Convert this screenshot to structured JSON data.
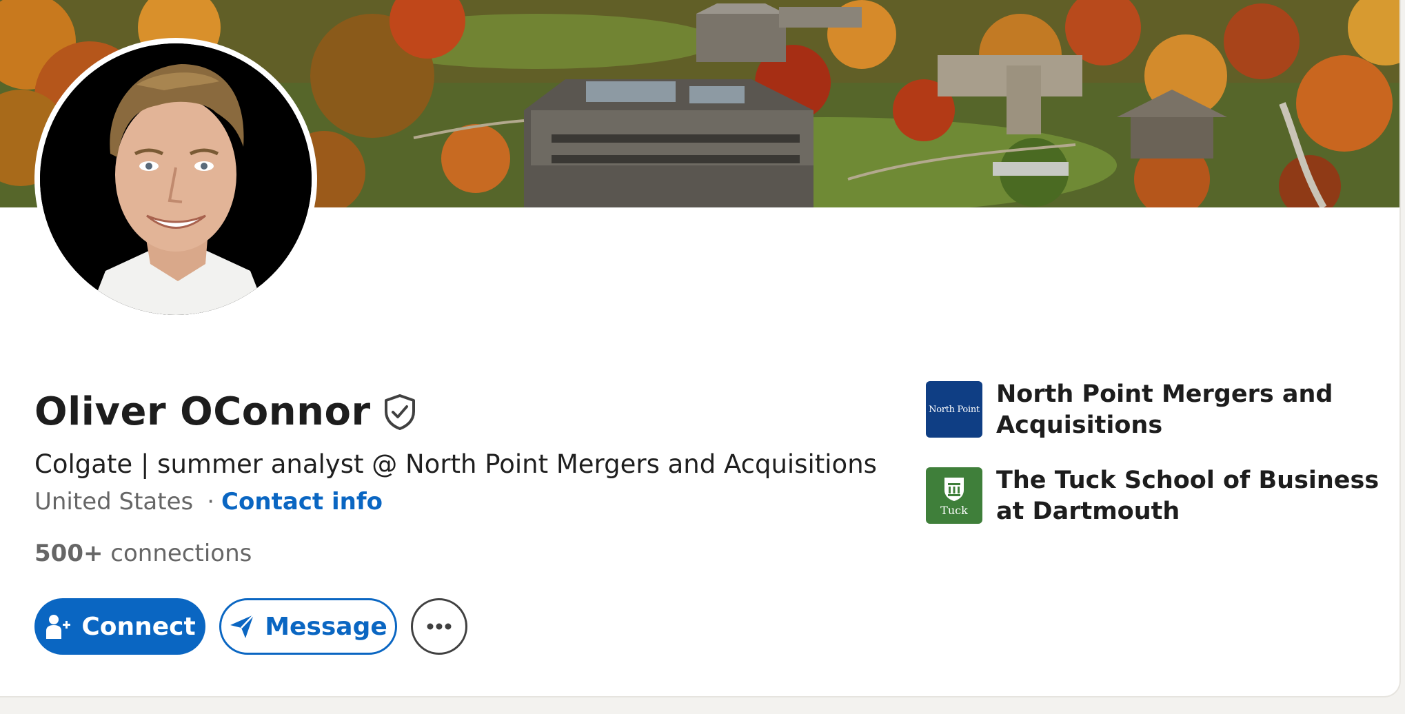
{
  "profile": {
    "name": "Oliver OConnor",
    "verified_icon": "shield-check-icon",
    "headline": "Colgate | summer analyst @ North Point Mergers and Acquisitions",
    "location": "United States",
    "separator": "·",
    "contact_info": "Contact info",
    "connections_count": "500+",
    "connections_label": "connections"
  },
  "actions": {
    "connect_label": "Connect",
    "connect_icon": "add-person-icon",
    "message_label": "Message",
    "message_icon": "paper-plane-icon",
    "more_icon": "more-horizontal-icon"
  },
  "organizations": [
    {
      "name": "North Point Mergers and Acquisitions",
      "logo_text": "North Point",
      "logo_color": "#0f3e84"
    },
    {
      "name": "The Tuck School of Business at Dartmouth",
      "logo_text": "Tuck",
      "logo_color": "#3f7f3a"
    }
  ],
  "colors": {
    "accent": "#0a66c2",
    "text_primary": "#1d1d1d",
    "text_secondary": "#666666"
  }
}
